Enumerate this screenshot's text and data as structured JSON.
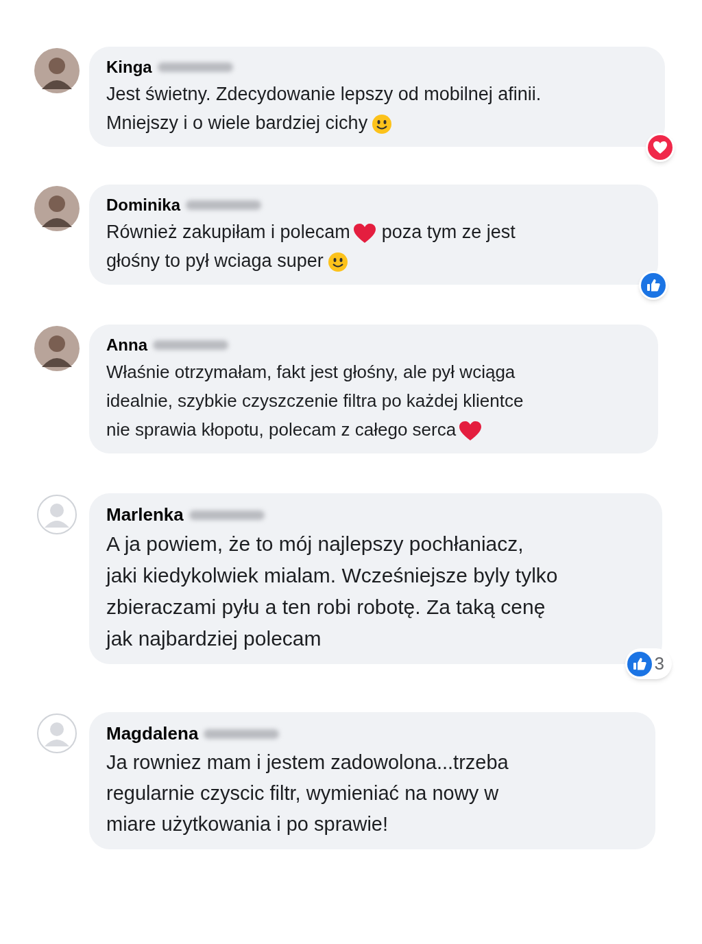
{
  "comments": [
    {
      "name": "Kinga",
      "surname_blurred": true,
      "avatar": {
        "kind": "photo"
      },
      "lines": [
        [
          {
            "kind": "text",
            "text": "Jest świetny. Zdecydowanie lepszy od mobilnej afinii."
          }
        ],
        [
          {
            "kind": "text",
            "text": "Mniejszy i o wiele bardziej cichy"
          },
          {
            "kind": "smile"
          }
        ]
      ],
      "reaction": {
        "kind": "heart"
      }
    },
    {
      "name": "Dominika",
      "surname_blurred": true,
      "avatar": {
        "kind": "photo"
      },
      "lines": [
        [
          {
            "kind": "text",
            "text": "Również zakupiłam i polecam"
          },
          {
            "kind": "heart"
          },
          {
            "kind": "text",
            "text": "poza tym ze jest"
          }
        ],
        [
          {
            "kind": "text",
            "text": "głośny to pył wciaga super"
          },
          {
            "kind": "smile"
          }
        ]
      ],
      "reaction": {
        "kind": "like"
      }
    },
    {
      "name": "Anna",
      "surname_blurred": true,
      "avatar": {
        "kind": "photo"
      },
      "lines": [
        [
          {
            "kind": "text",
            "text": "Właśnie otrzymałam, fakt jest głośny, ale pył wciąga"
          }
        ],
        [
          {
            "kind": "text",
            "text": "idealnie, szybkie czyszczenie filtra po każdej klientce"
          }
        ],
        [
          {
            "kind": "text",
            "text": "nie sprawia kłopotu, polecam z całego serca"
          },
          {
            "kind": "heart"
          }
        ]
      ]
    },
    {
      "name": "Marlenka",
      "surname_blurred": true,
      "avatar": {
        "kind": "default"
      },
      "lines": [
        [
          {
            "kind": "text",
            "text": "A ja powiem, że to mój najlepszy pochłaniacz,"
          }
        ],
        [
          {
            "kind": "text",
            "text": "jaki kiedykolwiek mialam. Wcześniejsze byly tylko"
          }
        ],
        [
          {
            "kind": "text",
            "text": "zbieraczami pyłu a ten robi robotę. Za taką cenę"
          }
        ],
        [
          {
            "kind": "text",
            "text": "jak najbardziej polecam"
          }
        ]
      ],
      "reaction": {
        "kind": "like",
        "count": "3"
      }
    },
    {
      "name": "Magdalena",
      "surname_blurred": true,
      "avatar": {
        "kind": "default"
      },
      "lines": [
        [
          {
            "kind": "text",
            "text": "Ja rowniez mam i jestem zadowolona...trzeba"
          }
        ],
        [
          {
            "kind": "text",
            "text": "regularnie czyscic filtr, wymieniać na nowy w"
          }
        ],
        [
          {
            "kind": "text",
            "text": "miare użytkowania i po sprawie!"
          }
        ]
      ]
    }
  ]
}
